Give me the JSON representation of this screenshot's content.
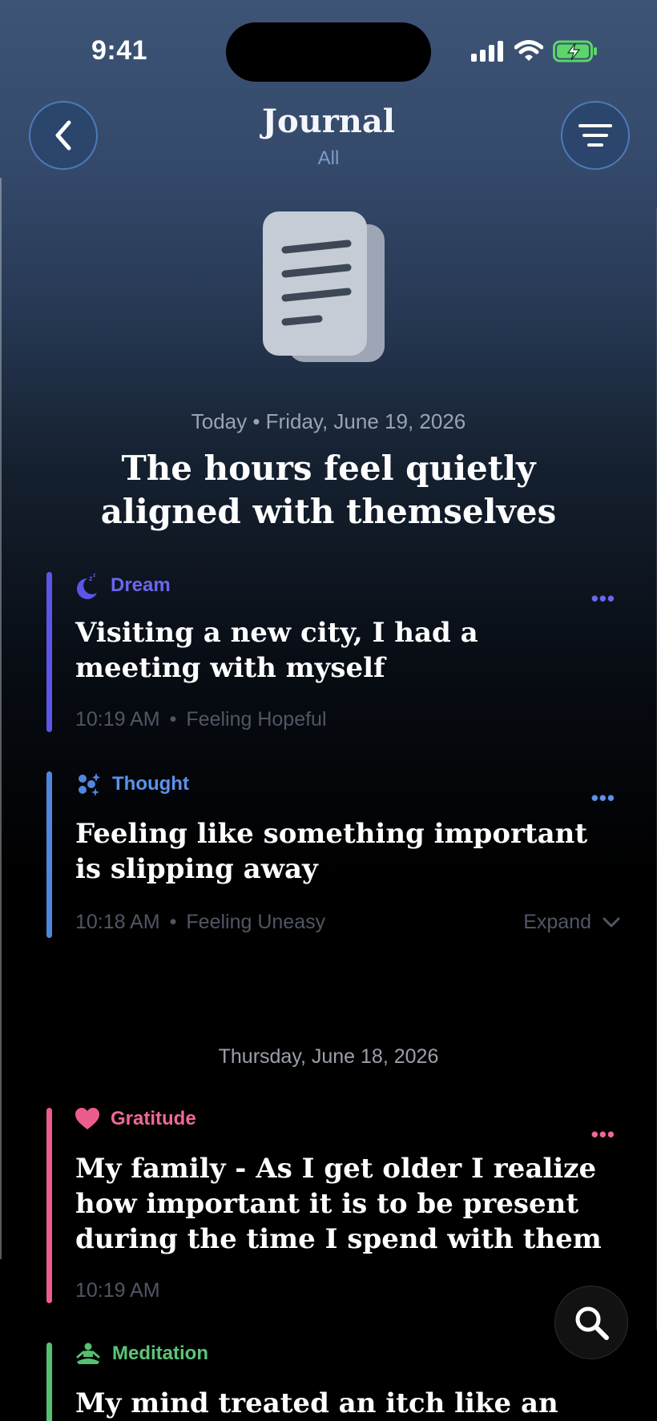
{
  "status_bar": {
    "time": "9:41"
  },
  "nav": {
    "title": "Journal",
    "subtitle": "All"
  },
  "hero": {
    "icon": "document-stack-icon",
    "date": "Today • Friday, June 19, 2026",
    "title": "The hours feel quietly aligned with themselves"
  },
  "entries_today": [
    {
      "category": "Dream",
      "icon": "moon-zzz-icon",
      "color": "#5b56e8",
      "title": "Visiting a new city, I had a meeting with myself",
      "time": "10:19 AM",
      "separator": "•",
      "feeling": "Feeling Hopeful"
    },
    {
      "category": "Thought",
      "icon": "sparkles-icon",
      "color": "#4f86e0",
      "title": "Feeling like something important is slipping away",
      "time": "10:18 AM",
      "separator": "•",
      "feeling": "Feeling Uneasy",
      "expand_label": "Expand"
    }
  ],
  "section_date": "Thursday, June 18, 2026",
  "entries_yesterday": [
    {
      "category": "Gratitude",
      "icon": "heart-icon",
      "color": "#ec5d8e",
      "title": "My family - As I get older I realize how important it is to be present during the time I spend with them",
      "time": "10:19 AM"
    },
    {
      "category": "Meditation",
      "icon": "meditation-icon",
      "color": "#54c071",
      "title": "My mind treated an itch like an"
    }
  ],
  "more_label": "•••"
}
